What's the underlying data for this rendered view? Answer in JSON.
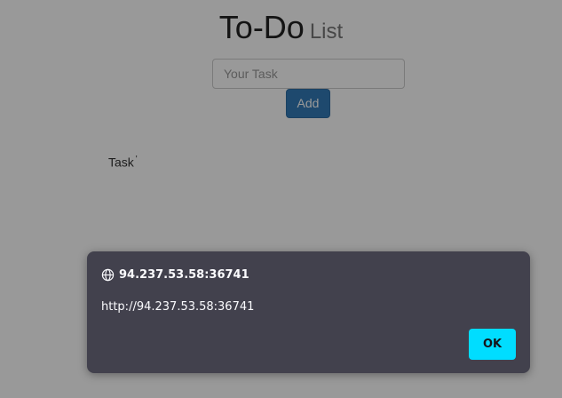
{
  "app": {
    "title_main": "To-Do",
    "title_sub": "List"
  },
  "form": {
    "task_placeholder": "Your Task",
    "task_value": "",
    "add_label": "Add"
  },
  "tasks": [
    {
      "label": "Task",
      "mark": "'"
    }
  ],
  "dialog": {
    "icon": "globe-icon",
    "origin": "94.237.53.58:36741",
    "message": "http://94.237.53.58:36741",
    "ok_label": "OK",
    "accent_color": "#00ddff",
    "background_color": "#42414d"
  }
}
